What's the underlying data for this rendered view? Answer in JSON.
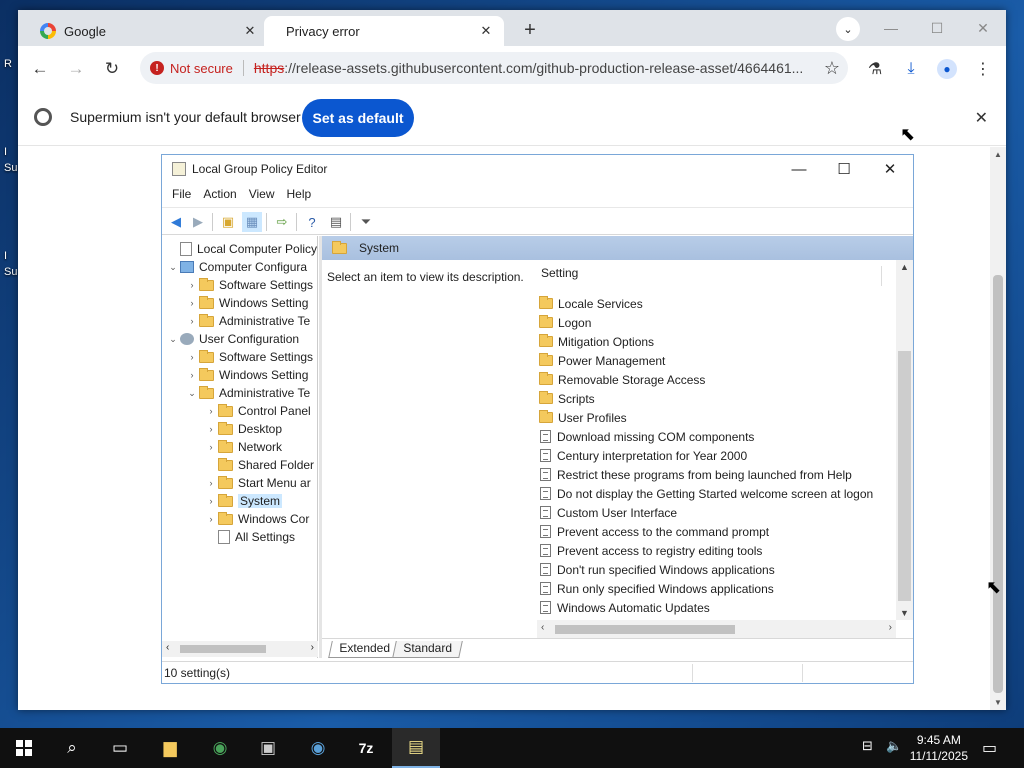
{
  "desktop": {
    "labels": [
      "R",
      "I",
      "Su",
      "I",
      "Su"
    ]
  },
  "browser": {
    "tabs": [
      {
        "title": "Google",
        "active": false
      },
      {
        "title": "Privacy error",
        "active": true
      }
    ],
    "new_tab": "+",
    "security_label": "Not secure",
    "url_scheme": "https",
    "url_rest": "://release-assets.githubusercontent.com/github-production-release-asset/4664461...",
    "infobar_message": "Supermium isn't your default browser",
    "infobar_button": "Set as default"
  },
  "gpedit": {
    "title": "Local Group Policy Editor",
    "menu": [
      "File",
      "Action",
      "View",
      "Help"
    ],
    "tree": [
      {
        "label": "Local Computer Policy",
        "level": 0,
        "icon": "doc",
        "chev": ""
      },
      {
        "label": "Computer Configura",
        "level": 0,
        "icon": "pc",
        "chev": "v"
      },
      {
        "label": "Software Settings",
        "level": 1,
        "icon": "folder",
        "chev": ">"
      },
      {
        "label": "Windows Setting",
        "level": 1,
        "icon": "folder",
        "chev": ">"
      },
      {
        "label": "Administrative Te",
        "level": 1,
        "icon": "folder",
        "chev": ">"
      },
      {
        "label": "User Configuration",
        "level": 0,
        "icon": "user",
        "chev": "v"
      },
      {
        "label": "Software Settings",
        "level": 1,
        "icon": "folder",
        "chev": ">"
      },
      {
        "label": "Windows Setting",
        "level": 1,
        "icon": "folder",
        "chev": ">"
      },
      {
        "label": "Administrative Te",
        "level": 1,
        "icon": "folder",
        "chev": "v"
      },
      {
        "label": "Control Panel",
        "level": 2,
        "icon": "folder",
        "chev": ">"
      },
      {
        "label": "Desktop",
        "level": 2,
        "icon": "folder",
        "chev": ">"
      },
      {
        "label": "Network",
        "level": 2,
        "icon": "folder",
        "chev": ">"
      },
      {
        "label": "Shared Folder",
        "level": 2,
        "icon": "folder",
        "chev": ""
      },
      {
        "label": "Start Menu ar",
        "level": 2,
        "icon": "folder",
        "chev": ">"
      },
      {
        "label": "System",
        "level": 2,
        "icon": "folder",
        "chev": ">",
        "selected": true
      },
      {
        "label": "Windows Cor",
        "level": 2,
        "icon": "folder",
        "chev": ">"
      },
      {
        "label": "All Settings",
        "level": 2,
        "icon": "doc",
        "chev": ""
      }
    ],
    "header": "System",
    "description": "Select an item to view its description.",
    "column_header": "Setting",
    "settings": [
      {
        "label": "Locale Services",
        "type": "folder"
      },
      {
        "label": "Logon",
        "type": "folder"
      },
      {
        "label": "Mitigation Options",
        "type": "folder"
      },
      {
        "label": "Power Management",
        "type": "folder"
      },
      {
        "label": "Removable Storage Access",
        "type": "folder"
      },
      {
        "label": "Scripts",
        "type": "folder"
      },
      {
        "label": "User Profiles",
        "type": "folder"
      },
      {
        "label": "Download missing COM components",
        "type": "setting"
      },
      {
        "label": "Century interpretation for Year 2000",
        "type": "setting"
      },
      {
        "label": "Restrict these programs from being launched from Help",
        "type": "setting"
      },
      {
        "label": "Do not display the Getting Started welcome screen at logon",
        "type": "setting"
      },
      {
        "label": "Custom User Interface",
        "type": "setting"
      },
      {
        "label": "Prevent access to the command prompt",
        "type": "setting"
      },
      {
        "label": "Prevent access to registry editing tools",
        "type": "setting"
      },
      {
        "label": "Don't run specified Windows applications",
        "type": "setting"
      },
      {
        "label": "Run only specified Windows applications",
        "type": "setting"
      },
      {
        "label": "Windows Automatic Updates",
        "type": "setting"
      }
    ],
    "view_tabs": [
      "Extended",
      "Standard"
    ],
    "status": "10 setting(s)"
  },
  "taskbar": {
    "time": "9:45 AM",
    "date": "11/11/2025",
    "apps": [
      "file-explorer-icon",
      "browser-icon",
      "terminal-icon",
      "browser-icon",
      "7zip-icon",
      "notepad-icon"
    ],
    "seven_zip_label": "7z"
  }
}
